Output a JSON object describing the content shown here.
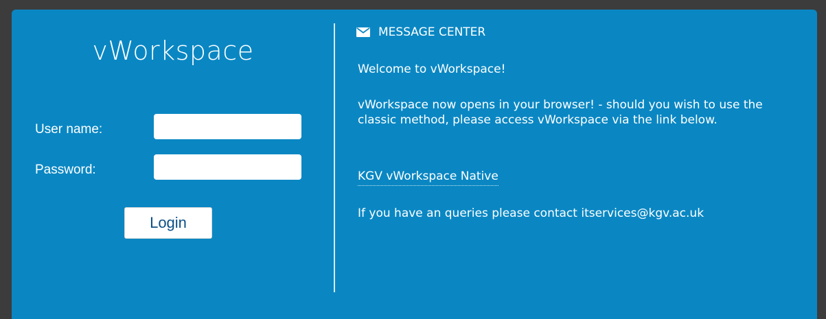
{
  "login": {
    "brand": "vWorkspace",
    "username_label": "User name:",
    "password_label": "Password:",
    "username_value": "",
    "password_value": "",
    "login_button": "Login"
  },
  "messages": {
    "header_icon": "envelope-icon",
    "header": "MESSAGE CENTER",
    "welcome": "Welcome to vWorkspace!",
    "intro": "vWorkspace now opens in your browser! - should you wish to use the classic method, please access vWorkspace via the link below.",
    "native_link": "KGV vWorkspace Native",
    "contact": "If you have an queries please contact itservices@kgv.ac.uk"
  },
  "colors": {
    "panel": "#0a87c3",
    "outer_background": "#3c3c3c",
    "login_text": "#0b4f85"
  }
}
